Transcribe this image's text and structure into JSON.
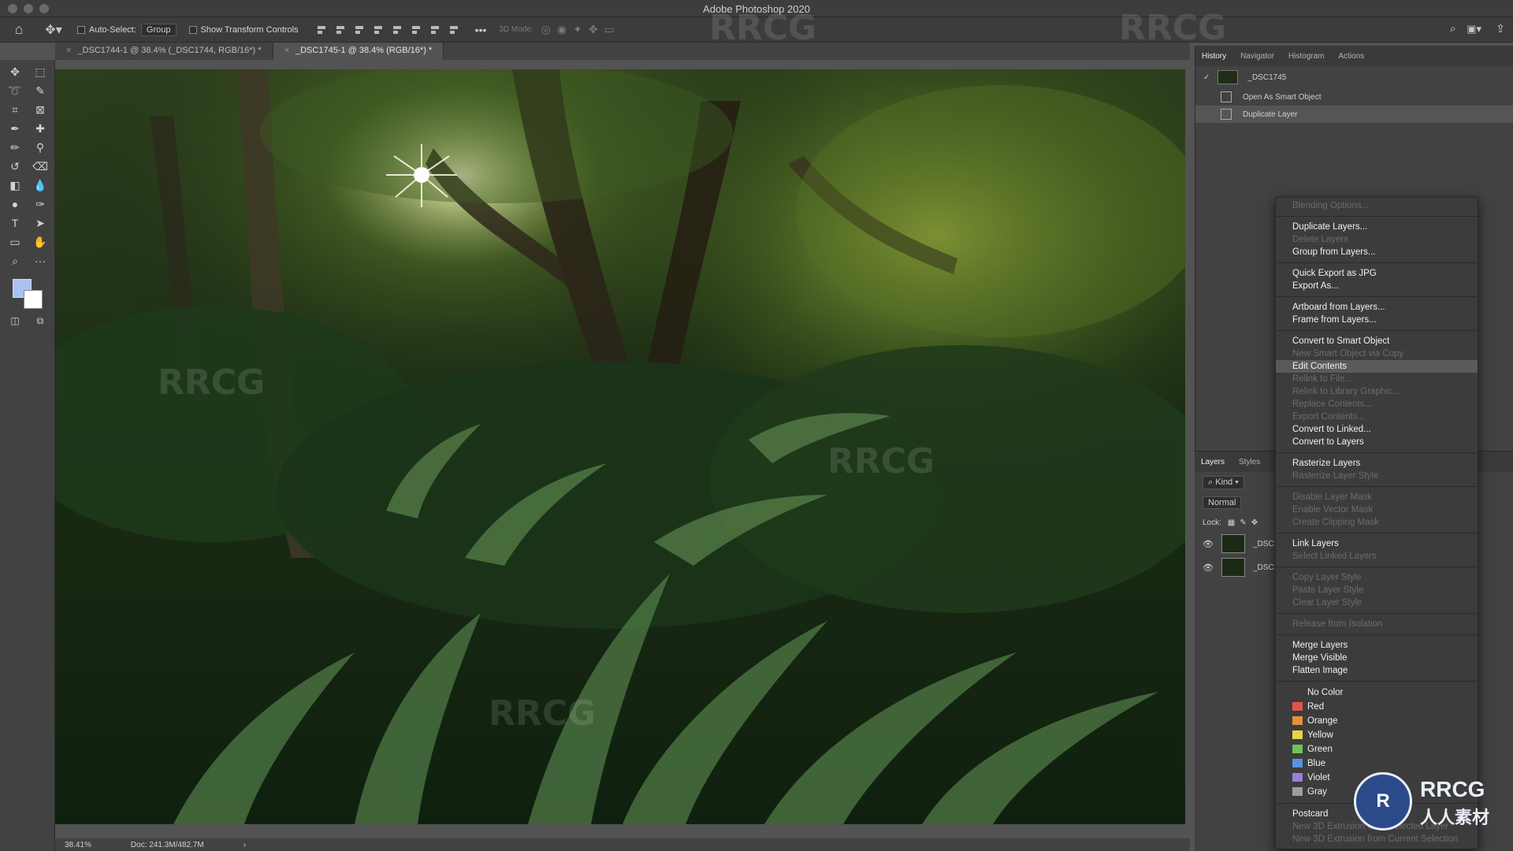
{
  "app": {
    "title": "Adobe Photoshop 2020"
  },
  "options": {
    "auto_select_label": "Auto-Select:",
    "auto_select_value": "Group",
    "show_transform_label": "Show Transform Controls",
    "mode3d_label": "3D Mode:"
  },
  "tabs": [
    {
      "label": "_DSC1744-1 @ 38.4% (_DSC1744, RGB/16*) *"
    },
    {
      "label": "_DSC1745-1 @ 38.4% (RGB/16*) *"
    }
  ],
  "history_panel": {
    "tabs": [
      "History",
      "Navigator",
      "Histogram",
      "Actions"
    ],
    "snapshot": "_DSC1745",
    "states": [
      "Open As Smart Object",
      "Duplicate Layer"
    ]
  },
  "layers_panel": {
    "tabs": [
      "Layers",
      "Styles"
    ],
    "kind_label": "Kind",
    "blend_mode": "Normal",
    "lock_label": "Lock:",
    "layers": [
      "_DSC1",
      "_DSC1"
    ]
  },
  "context_menu": {
    "groups": [
      [
        {
          "label": "Blending Options...",
          "disabled": true
        }
      ],
      [
        {
          "label": "Duplicate Layers...",
          "disabled": false
        },
        {
          "label": "Delete Layers",
          "disabled": true
        },
        {
          "label": "Group from Layers...",
          "disabled": false
        }
      ],
      [
        {
          "label": "Quick Export as JPG",
          "disabled": false
        },
        {
          "label": "Export As...",
          "disabled": false
        }
      ],
      [
        {
          "label": "Artboard from Layers...",
          "disabled": false
        },
        {
          "label": "Frame from Layers...",
          "disabled": false
        }
      ],
      [
        {
          "label": "Convert to Smart Object",
          "disabled": false
        },
        {
          "label": "New Smart Object via Copy",
          "disabled": true
        },
        {
          "label": "Edit Contents",
          "disabled": false,
          "highlighted": true
        },
        {
          "label": "Relink to File...",
          "disabled": true
        },
        {
          "label": "Relink to Library Graphic...",
          "disabled": true
        },
        {
          "label": "Replace Contents...",
          "disabled": true
        },
        {
          "label": "Export Contents...",
          "disabled": true
        },
        {
          "label": "Convert to Linked...",
          "disabled": false
        },
        {
          "label": "Convert to Layers",
          "disabled": false
        }
      ],
      [
        {
          "label": "Rasterize Layers",
          "disabled": false
        },
        {
          "label": "Rasterize Layer Style",
          "disabled": true
        }
      ],
      [
        {
          "label": "Disable Layer Mask",
          "disabled": true
        },
        {
          "label": "Enable Vector Mask",
          "disabled": true
        },
        {
          "label": "Create Clipping Mask",
          "disabled": true
        }
      ],
      [
        {
          "label": "Link Layers",
          "disabled": false
        },
        {
          "label": "Select Linked Layers",
          "disabled": true
        }
      ],
      [
        {
          "label": "Copy Layer Style",
          "disabled": true
        },
        {
          "label": "Paste Layer Style",
          "disabled": true
        },
        {
          "label": "Clear Layer Style",
          "disabled": true
        }
      ],
      [
        {
          "label": "Release from Isolation",
          "disabled": true
        }
      ],
      [
        {
          "label": "Merge Layers",
          "disabled": false
        },
        {
          "label": "Merge Visible",
          "disabled": false
        },
        {
          "label": "Flatten Image",
          "disabled": false
        }
      ]
    ],
    "colors": [
      {
        "label": "No Color",
        "color": ""
      },
      {
        "label": "Red",
        "color": "#e0524f"
      },
      {
        "label": "Orange",
        "color": "#e8903b"
      },
      {
        "label": "Yellow",
        "color": "#e7d34a"
      },
      {
        "label": "Green",
        "color": "#6fc35a"
      },
      {
        "label": "Blue",
        "color": "#5a92e0"
      },
      {
        "label": "Violet",
        "color": "#9a7fd6"
      },
      {
        "label": "Gray",
        "color": "#9e9e9e"
      }
    ],
    "tail": [
      {
        "label": "Postcard",
        "disabled": false
      },
      {
        "label": "New 3D Extrusion from Selected Layer",
        "disabled": true
      },
      {
        "label": "New 3D Extrusion from Current Selection",
        "disabled": true
      }
    ]
  },
  "status": {
    "zoom": "38.41%",
    "doc": "Doc: 241.3M/482.7M"
  },
  "watermark": {
    "text": "RRCG",
    "logo_text": "RRCG",
    "logo_sub": "人人素材"
  }
}
